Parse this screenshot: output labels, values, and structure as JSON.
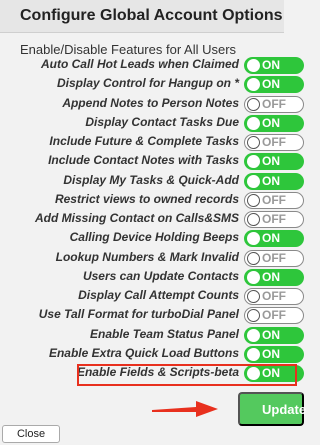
{
  "header": {
    "title": "Configure Global Account Options"
  },
  "section_label": "Enable/Disable Features for All Users",
  "toggle_labels": {
    "on": "ON",
    "off": "OFF"
  },
  "options": [
    {
      "label": "Auto Call Hot Leads when Claimed",
      "state": "on"
    },
    {
      "label": "Display Control for Hangup on *",
      "state": "on"
    },
    {
      "label": "Append Notes to Person Notes",
      "state": "off"
    },
    {
      "label": "Display Contact Tasks Due",
      "state": "on"
    },
    {
      "label": "Include Future & Complete Tasks",
      "state": "off"
    },
    {
      "label": "Include Contact Notes with Tasks",
      "state": "on"
    },
    {
      "label": "Display My Tasks & Quick-Add",
      "state": "on"
    },
    {
      "label": "Restrict views to owned records",
      "state": "off"
    },
    {
      "label": "Add Missing Contact on Calls&SMS",
      "state": "off"
    },
    {
      "label": "Calling Device Holding Beeps",
      "state": "on"
    },
    {
      "label": "Lookup Numbers & Mark Invalid",
      "state": "off"
    },
    {
      "label": "Users can Update Contacts",
      "state": "on"
    },
    {
      "label": "Display Call Attempt Counts",
      "state": "off"
    },
    {
      "label": "Use Tall Format for turboDial Panel",
      "state": "off"
    },
    {
      "label": "Enable Team Status Panel",
      "state": "on"
    },
    {
      "label": "Enable Extra Quick Load Buttons",
      "state": "on"
    },
    {
      "label": "Enable Fields & Scripts-beta",
      "state": "on"
    }
  ],
  "buttons": {
    "update_label": "Update",
    "close_label": "Close"
  },
  "colors": {
    "toggle_on": "#2ec63b",
    "update_button": "#54c95e",
    "highlight": "#e8301e"
  }
}
